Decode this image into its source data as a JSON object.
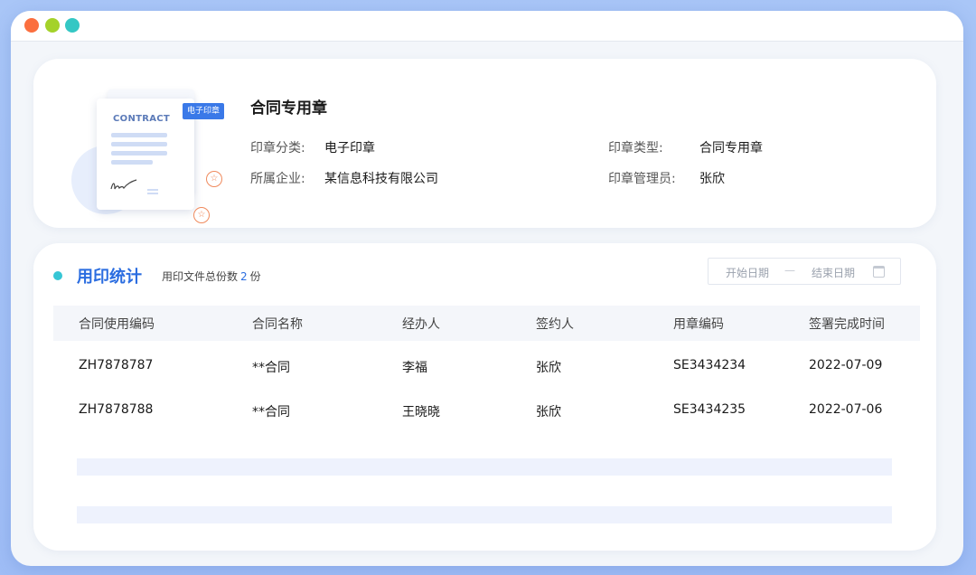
{
  "window": {
    "traffic_lights": [
      "close",
      "minimize",
      "maximize"
    ]
  },
  "seal": {
    "illustration": {
      "doc_title": "CONTRACT",
      "badge": "电子印章",
      "stamp_glyph": "☆"
    },
    "name": "合同专用章",
    "fields": [
      {
        "label": "印章分类:",
        "value": "电子印章"
      },
      {
        "label": "印章类型:",
        "value": "合同专用章"
      },
      {
        "label": "所属企业:",
        "value": "某信息科技有限公司"
      },
      {
        "label": "印章管理员:",
        "value": "张欣"
      }
    ]
  },
  "stats": {
    "title": "用印统计",
    "subtitle_prefix": "用印文件总份数",
    "total": "2",
    "subtitle_suffix": "份",
    "date_range": {
      "start_placeholder": "开始日期",
      "separator": "—",
      "end_placeholder": "结束日期",
      "icon": "calendar-icon"
    },
    "columns": [
      "合同使用编码",
      "合同名称",
      "经办人",
      "签约人",
      "用章编码",
      "签署完成时间"
    ],
    "rows": [
      [
        "ZH7878787",
        "**合同",
        "李福",
        "张欣",
        "SE3434234",
        "2022-07-09"
      ],
      [
        "ZH7878788",
        "**合同",
        "王晓晓",
        "张欣",
        "SE3434235",
        "2022-07-06"
      ]
    ]
  },
  "colors": {
    "accent": "#2b6de0",
    "dot": "#36c6d5",
    "badge": "#3a79e8",
    "stamp": "#f08a5d"
  }
}
